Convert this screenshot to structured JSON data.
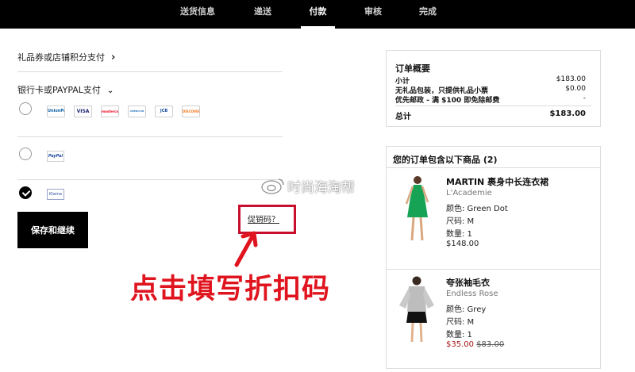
{
  "nav": {
    "steps": [
      {
        "label": "送货信息",
        "active": false
      },
      {
        "label": "递送",
        "active": false
      },
      {
        "label": "付款",
        "active": true
      },
      {
        "label": "审核",
        "active": false
      },
      {
        "label": "完成",
        "active": false
      }
    ]
  },
  "payment": {
    "gift_card_label": "礼品券或店铺积分支付",
    "gift_card_chevron": "›",
    "bank_paypal_label": "银行卡或PAYPAL支付",
    "bank_paypal_chevron": "⌄",
    "card_logos": [
      "UnionPay",
      "VISA",
      "mastercard",
      "AMERICAN EXPRESS",
      "JCB",
      "DISCOVER"
    ],
    "paypal_logo": "PayPal",
    "klarna_logo": "Klarna",
    "selected_method": "klarna",
    "save_button": "保存和继续",
    "promo_link": "促销码？"
  },
  "annotation": {
    "text": "点击填写折扣码",
    "color": "#e0141e"
  },
  "watermark": {
    "text": "时尚海淘帮"
  },
  "summary": {
    "title": "订单概要",
    "rows": [
      {
        "label": "小计",
        "value": "$183.00"
      },
      {
        "label": "无礼品包装，只提供礼品小票",
        "value": "$0.00"
      },
      {
        "label": "优先邮政 - 满 $100 即免除邮费",
        "value": "-"
      }
    ],
    "total_label": "总计",
    "total_value": "$183.00"
  },
  "items": {
    "title": "您的订单包含以下商品 (2)",
    "list": [
      {
        "name": "MARTIN 裹身中长连衣裙",
        "brand": "L'Academie",
        "color": "颜色: Green Dot",
        "size": "尺码: M",
        "qty": "数量: 1",
        "price": "$148.00"
      },
      {
        "name": "夸张袖毛衣",
        "brand": "Endless Rose",
        "color": "颜色: Grey",
        "size": "尺码: M",
        "qty": "数量: 1",
        "sale_price": "$35.00",
        "original_price": "$83.00"
      }
    ]
  }
}
